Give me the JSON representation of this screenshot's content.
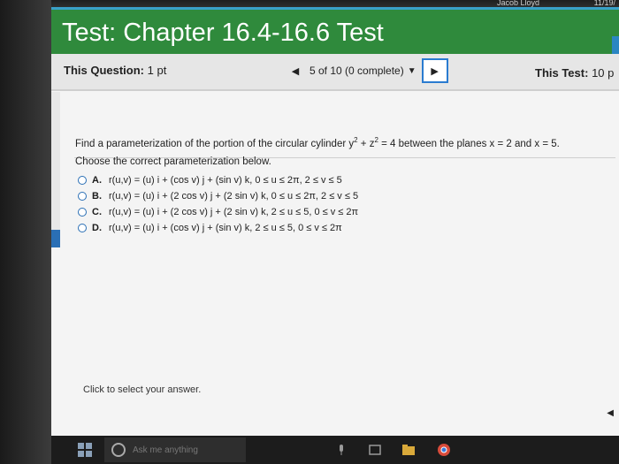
{
  "system": {
    "top_user": "Jacob Lloyd",
    "top_date": "11/19/"
  },
  "header": {
    "title": "Test: Chapter 16.4-16.6 Test"
  },
  "question_bar": {
    "this_question_label": "This Question:",
    "this_question_value": "1 pt",
    "nav_prev_icon": "arrow-left-icon",
    "nav_status": "5 of 10 (0 complete)",
    "nav_next_icon": "arrow-right-icon",
    "this_test_label": "This Test:",
    "this_test_value": "10 p"
  },
  "question": {
    "prompt_part1": "Find a parameterization of the portion of the circular cylinder y",
    "prompt_sup1": "2",
    "prompt_part2": " + z",
    "prompt_sup2": "2",
    "prompt_part3": " = 4 between the planes x = 2 and x = 5.",
    "instruction": "Choose the correct parameterization below.",
    "options": [
      {
        "letter": "A.",
        "text": "r(u,v) = (u) i + (cos v) j + (sin v) k, 0 ≤ u ≤ 2π, 2 ≤ v ≤ 5"
      },
      {
        "letter": "B.",
        "text": "r(u,v) = (u) i + (2 cos v) j + (2 sin v) k, 0 ≤ u ≤ 2π, 2 ≤ v ≤ 5"
      },
      {
        "letter": "C.",
        "text": "r(u,v) = (u) i + (2 cos v) j + (2 sin v) k, 2 ≤ u ≤ 5, 0 ≤ v ≤ 2π"
      },
      {
        "letter": "D.",
        "text": "r(u,v) = (u) i + (cos v) j + (sin v) k, 2 ≤ u ≤ 5, 0 ≤ v ≤ 2π"
      }
    ]
  },
  "footer": {
    "hint": "Click to select your answer."
  },
  "taskbar": {
    "search_placeholder": "Ask me anything"
  },
  "colors": {
    "header_green": "#2f8a3c",
    "accent_blue": "#2a7bd0"
  }
}
